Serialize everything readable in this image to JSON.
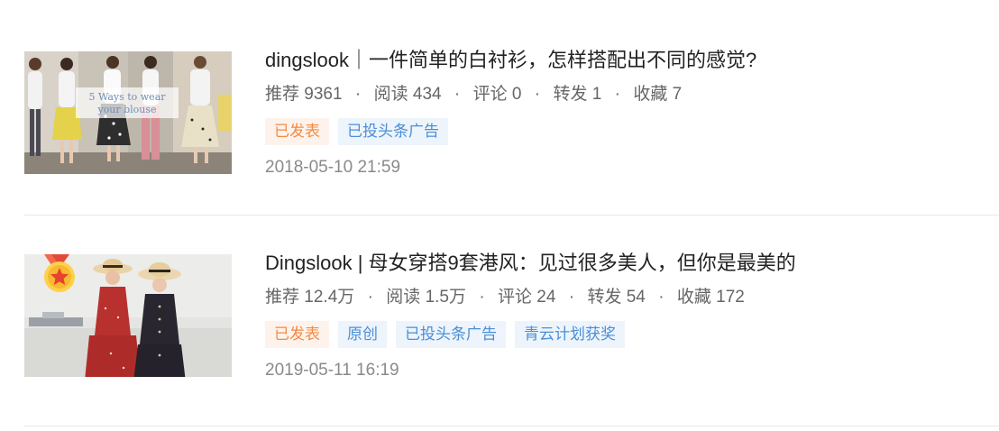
{
  "articles": [
    {
      "title": "dingslook｜一件简单的白衬衫，怎样搭配出不同的感觉?",
      "stats": [
        {
          "label": "推荐",
          "value": "9361"
        },
        {
          "label": "阅读",
          "value": "434"
        },
        {
          "label": "评论",
          "value": "0"
        },
        {
          "label": "转发",
          "value": "1"
        },
        {
          "label": "收藏",
          "value": "7"
        }
      ],
      "tags": [
        {
          "text": "已发表",
          "color": "orange"
        },
        {
          "text": "已投头条广告",
          "color": "blue"
        }
      ],
      "date": "2018-05-10 21:59",
      "thumbnail": {
        "overlay_line1": "5  Ways  to  wear",
        "overlay_line2": "your  blouse",
        "award_badge": false
      }
    },
    {
      "title": "Dingslook | 母女穿搭9套港风：见过很多美人，但你是最美的",
      "stats": [
        {
          "label": "推荐",
          "value": "12.4万"
        },
        {
          "label": "阅读",
          "value": "1.5万"
        },
        {
          "label": "评论",
          "value": "24"
        },
        {
          "label": "转发",
          "value": "54"
        },
        {
          "label": "收藏",
          "value": "172"
        }
      ],
      "tags": [
        {
          "text": "已发表",
          "color": "orange"
        },
        {
          "text": "原创",
          "color": "blue"
        },
        {
          "text": "已投头条广告",
          "color": "blue"
        },
        {
          "text": "青云计划获奖",
          "color": "blue"
        }
      ],
      "date": "2019-05-11 16:19",
      "thumbnail": {
        "award_badge": true,
        "award_icon": "star-medal-icon"
      }
    }
  ],
  "separator": "·",
  "colors": {
    "title": "#222222",
    "meta": "#666666",
    "date": "#8a8a8a",
    "tag_orange": "#f48a45",
    "tag_orange_bg": "#fef3ec",
    "tag_blue": "#4b8fd5",
    "tag_blue_bg": "#edf4fb",
    "divider": "#e8e8e8"
  }
}
